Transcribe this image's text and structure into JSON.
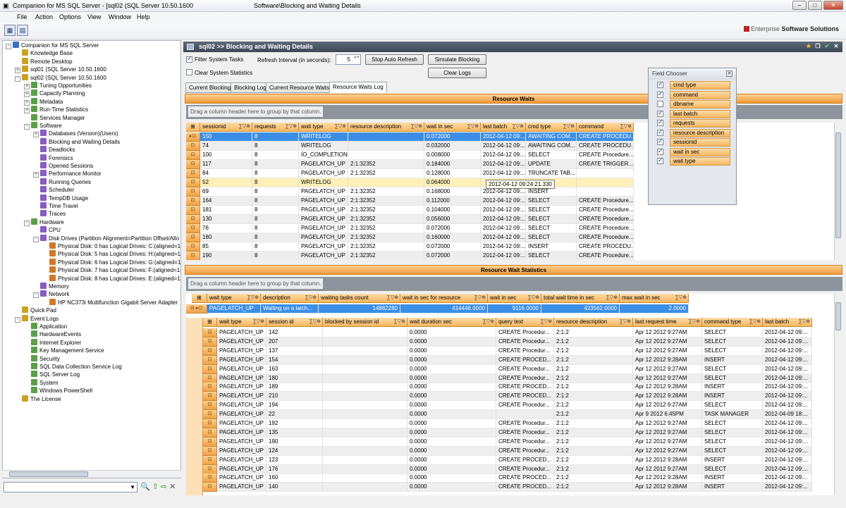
{
  "window": {
    "title": "Companion for MS SQL Server - [sql02 (SQL Server 10.50.1600",
    "center_title": "Software\\Blocking and Waiting Details",
    "controls": {
      "minimize": "–",
      "maximize": "□",
      "close": "✕"
    }
  },
  "menu": [
    "File",
    "Action",
    "Options",
    "View",
    "Window",
    "Help"
  ],
  "brand": {
    "prefix": "Enterprise",
    "name": "Software Solutions"
  },
  "tree": [
    {
      "label": "Companion for MS SQL Server",
      "level": 0,
      "exp": "-"
    },
    {
      "label": "Knowledge Base",
      "level": 1,
      "exp": ""
    },
    {
      "label": "Remote Desktop",
      "level": 1,
      "exp": ""
    },
    {
      "label": "sql01 (SQL Server 10.50.1600",
      "level": 1,
      "exp": "+"
    },
    {
      "label": "sql02 (SQL Server 10.50.1600",
      "level": 1,
      "exp": "-"
    },
    {
      "label": "Tuning Opportunities",
      "level": 2,
      "exp": "+"
    },
    {
      "label": "Capacity Planning",
      "level": 2,
      "exp": "+"
    },
    {
      "label": "Metadata",
      "level": 2,
      "exp": "+"
    },
    {
      "label": "Run-Time Statistics",
      "level": 2,
      "exp": "+"
    },
    {
      "label": "Services Manager",
      "level": 2,
      "exp": ""
    },
    {
      "label": "Software",
      "level": 2,
      "exp": "-"
    },
    {
      "label": "Databases (Version)(Users)",
      "level": 3,
      "exp": "+"
    },
    {
      "label": "Blocking and Waiting Details",
      "level": 3,
      "exp": ""
    },
    {
      "label": "Deadlocks",
      "level": 3,
      "exp": ""
    },
    {
      "label": "Forensics",
      "level": 3,
      "exp": ""
    },
    {
      "label": "Opened Sessions",
      "level": 3,
      "exp": ""
    },
    {
      "label": "Performance Monitor",
      "level": 3,
      "exp": "+"
    },
    {
      "label": "Running Queries",
      "level": 3,
      "exp": ""
    },
    {
      "label": "Scheduler",
      "level": 3,
      "exp": ""
    },
    {
      "label": "TempDB Usage",
      "level": 3,
      "exp": ""
    },
    {
      "label": "Time Travel",
      "level": 3,
      "exp": ""
    },
    {
      "label": "Traces",
      "level": 3,
      "exp": ""
    },
    {
      "label": "Hardware",
      "level": 2,
      "exp": "-"
    },
    {
      "label": "CPU",
      "level": 3,
      "exp": ""
    },
    {
      "label": "Disk Drives (Partition Alignment=Partition Offset/Allo",
      "level": 3,
      "exp": "-"
    },
    {
      "label": "Physical Disk: 0 has Logical Drives: C:(aligned=1(",
      "level": 4,
      "exp": ""
    },
    {
      "label": "Physical Disk: 5 has Logical Drives: H:(aligned=1(",
      "level": 4,
      "exp": ""
    },
    {
      "label": "Physical Disk: 6 has Logical Drives: G:(aligned=1(",
      "level": 4,
      "exp": ""
    },
    {
      "label": "Physical Disk: 7 has Logical Drives: F:(aligned=1(",
      "level": 4,
      "exp": ""
    },
    {
      "label": "Physical Disk: 8 has Logical Drives: E:(aligned=1(",
      "level": 4,
      "exp": ""
    },
    {
      "label": "Memory",
      "level": 3,
      "exp": ""
    },
    {
      "label": "Network",
      "level": 3,
      "exp": "-"
    },
    {
      "label": "HP NC373i Multifunction Gigabit Server Adapter",
      "level": 4,
      "exp": ""
    },
    {
      "label": "Quick Pad",
      "level": 1,
      "exp": ""
    },
    {
      "label": "Event Logs",
      "level": 1,
      "exp": "-"
    },
    {
      "label": "Application",
      "level": 2,
      "exp": ""
    },
    {
      "label": "HardwareEvents",
      "level": 2,
      "exp": ""
    },
    {
      "label": "Internet Explorer",
      "level": 2,
      "exp": ""
    },
    {
      "label": "Key Management Service",
      "level": 2,
      "exp": ""
    },
    {
      "label": "Security",
      "level": 2,
      "exp": ""
    },
    {
      "label": "SQL Data Collection Service Log",
      "level": 2,
      "exp": ""
    },
    {
      "label": "SQL Server Log",
      "level": 2,
      "exp": ""
    },
    {
      "label": "System",
      "level": 2,
      "exp": ""
    },
    {
      "label": "Windows PowerShell",
      "level": 2,
      "exp": ""
    },
    {
      "label": "The License",
      "level": 1,
      "exp": ""
    }
  ],
  "panel": {
    "title": "sql02 >> Blocking and Waiting Details",
    "filter_system_tasks": "Filter System Tasks",
    "clear_system_statistics": "Clear System Statistics",
    "refresh_label": "Refresh Interval (in seconds):",
    "refresh_value": "5",
    "stop_auto_refresh": "Stop Auto Refresh",
    "simulate_blocking": "Simulate Blocking",
    "clear_logs": "Clear Logs",
    "tabs": [
      "Current Blocking",
      "Blocking Log",
      "Current Resource Waits",
      "Resource Waits Log"
    ]
  },
  "resource_waits": {
    "band": "Resource Waits",
    "group_hint": "Drag a column header here to group by that column.",
    "columns": [
      "sessionid",
      "requests",
      "wait type",
      "resource description",
      "wait in sec",
      "last batch",
      "cmd type",
      "command"
    ],
    "rows": [
      [
        "150",
        "8",
        "WRITELOG",
        "",
        "0.072000",
        "2012-04-12  09:...",
        "AWAITING COM...",
        "CREATE PROCEDU..."
      ],
      [
        "74",
        "8",
        "WRITELOG",
        "",
        "0.032000",
        "2012-04-12  09:...",
        "AWAITING COM...",
        "CREATE PROCEDU..."
      ],
      [
        "100",
        "8",
        "IO_COMPLETION",
        "",
        "0.008000",
        "2012-04-12  09:...",
        "SELECT",
        "CREATE Procedure..."
      ],
      [
        "117",
        "8",
        "PAGELATCH_UP",
        "2:1:32352",
        "0.184000",
        "2012-04-12  09:...",
        "UPDATE",
        "CREATE TRIGGER..."
      ],
      [
        "84",
        "8",
        "PAGELATCH_UP",
        "2:1:32352",
        "0.128000",
        "2012-04-12  09:...",
        "TRUNCATE TAB...",
        ""
      ],
      [
        "52",
        "8",
        "WRITELOG",
        "",
        "0.064000",
        "",
        "",
        ""
      ],
      [
        "69",
        "8",
        "PAGELATCH_UP",
        "2:1:32352",
        "0.168000",
        "2012-04-12  09:...",
        "INSERT",
        ""
      ],
      [
        "164",
        "8",
        "PAGELATCH_UP",
        "2:1:32352",
        "0.112000",
        "2012-04-12  09:...",
        "SELECT",
        "CREATE Procedure..."
      ],
      [
        "181",
        "8",
        "PAGELATCH_UP",
        "2:1:32352",
        "0.104000",
        "2012-04-12  09:...",
        "SELECT",
        "CREATE Procedure..."
      ],
      [
        "130",
        "8",
        "PAGELATCH_UP",
        "2:1:32352",
        "0.056000",
        "2012-04-12  09:...",
        "SELECT",
        "CREATE Procedure..."
      ],
      [
        "76",
        "8",
        "PAGELATCH_UP",
        "2:1:32352",
        "0.072000",
        "2012-04-12  09:...",
        "SELECT",
        "CREATE Procedure..."
      ],
      [
        "180",
        "8",
        "PAGELATCH_UP",
        "2:1:32352",
        "0.160000",
        "2012-04-12  09:...",
        "SELECT",
        "CREATE Procedure..."
      ],
      [
        "85",
        "8",
        "PAGELATCH_UP",
        "2:1:32352",
        "0.072000",
        "2012-04-12  09:...",
        "INSERT",
        "CREATE PROCEDU..."
      ],
      [
        "190",
        "8",
        "PAGELATCH_UP",
        "2:1:32352",
        "0.072000",
        "2012-04-12  09:...",
        "SELECT",
        "CREATE Procedure..."
      ]
    ],
    "tooltip": "2012-04-12 09:24:21.330"
  },
  "field_chooser": {
    "title": "Field Chooser",
    "items": [
      {
        "name": "cmd type",
        "checked": true
      },
      {
        "name": "command",
        "checked": true
      },
      {
        "name": "dbname",
        "checked": false
      },
      {
        "name": "last batch",
        "checked": true
      },
      {
        "name": "requests",
        "checked": true
      },
      {
        "name": "resource description",
        "checked": true
      },
      {
        "name": "sessionid",
        "checked": true
      },
      {
        "name": "wait in sec",
        "checked": true
      },
      {
        "name": "wait type",
        "checked": true
      }
    ]
  },
  "wait_stats": {
    "band": "Resource Wait Statistics",
    "group_hint": "Drag a column header here to group by that column.",
    "columns": [
      "wait type",
      "description",
      "waiting tasks count",
      "wait in sec for resource",
      "wait in sec",
      "total wait time in sec",
      "max wait in sec"
    ],
    "row": [
      "PAGELATCH_UP",
      "Waiting on a latch...",
      "14882280",
      "414446.0000",
      "9116.0000",
      "423562.0000",
      "2.0000"
    ],
    "child_columns": [
      "wait type",
      "session id",
      "blocked by session id",
      "wait duration sec",
      "query text",
      "resource description",
      "last request time",
      "command type",
      "last batch"
    ],
    "child_rows": [
      [
        "PAGELATCH_UP",
        "142",
        "",
        "0.0000",
        "CREATE Procedur...",
        "2:1:2",
        "Apr 12 2012  9:27AM",
        "SELECT",
        "2012-04-12  09:..."
      ],
      [
        "PAGELATCH_UP",
        "207",
        "",
        "0.0000",
        "CREATE Procedur...",
        "2:1:2",
        "Apr 12 2012  9:27AM",
        "SELECT",
        "2012-04-12  09:..."
      ],
      [
        "PAGELATCH_UP",
        "137",
        "",
        "0.0000",
        "CREATE Procedur...",
        "2:1:2",
        "Apr 12 2012  9:27AM",
        "SELECT",
        "2012-04-12  09:..."
      ],
      [
        "PAGELATCH_UP",
        "154",
        "",
        "0.0000",
        "CREATE PROCED...",
        "2:1:2",
        "Apr 12 2012  9:28AM",
        "INSERT",
        "2012-04-12  09:..."
      ],
      [
        "PAGELATCH_UP",
        "163",
        "",
        "0.0000",
        "CREATE Procedur...",
        "2:1:2",
        "Apr 12 2012  9:27AM",
        "SELECT",
        "2012-04-12  09:..."
      ],
      [
        "PAGELATCH_UP",
        "180",
        "",
        "0.0000",
        "CREATE Procedur...",
        "2:1:2",
        "Apr 12 2012  9:27AM",
        "SELECT",
        "2012-04-12  09:..."
      ],
      [
        "PAGELATCH_UP",
        "189",
        "",
        "0.0000",
        "CREATE PROCED...",
        "2:1:2",
        "Apr 12 2012  9:28AM",
        "INSERT",
        "2012-04-12  09:..."
      ],
      [
        "PAGELATCH_UP",
        "210",
        "",
        "0.0000",
        "CREATE PROCED...",
        "2:1:2",
        "Apr 12 2012  9:28AM",
        "INSERT",
        "2012-04-12  09:..."
      ],
      [
        "PAGELATCH_UP",
        "194",
        "",
        "0.0000",
        "CREATE Procedur...",
        "2:1:2",
        "Apr 12 2012  9:27AM",
        "SELECT",
        "2012-04-12  09:..."
      ],
      [
        "PAGELATCH_UP",
        "22",
        "",
        "0.0000",
        "",
        "2:1:2",
        "Apr  9 2012  6:45PM",
        "TASK MANAGER",
        "2012-04-09  18:..."
      ],
      [
        "PAGELATCH_UP",
        "192",
        "",
        "0.0000",
        "CREATE Procedur...",
        "2:1:2",
        "Apr 12 2012  9:27AM",
        "SELECT",
        "2012-04-12  09:..."
      ],
      [
        "PAGELATCH_UP",
        "135",
        "",
        "0.0000",
        "CREATE Procedur...",
        "2:1:2",
        "Apr 12 2012  9:27AM",
        "SELECT",
        "2012-04-12  09:..."
      ],
      [
        "PAGELATCH_UP",
        "190",
        "",
        "0.0000",
        "CREATE Procedur...",
        "2:1:2",
        "Apr 12 2012  9:27AM",
        "SELECT",
        "2012-04-12  09:..."
      ],
      [
        "PAGELATCH_UP",
        "124",
        "",
        "0.0000",
        "CREATE Procedur...",
        "2:1:2",
        "Apr 12 2012  9:27AM",
        "SELECT",
        "2012-04-12  09:..."
      ],
      [
        "PAGELATCH_UP",
        "123",
        "",
        "0.0000",
        "CREATE PROCED...",
        "2:1:2",
        "Apr 12 2012  9:28AM",
        "INSERT",
        "2012-04-12  09:..."
      ],
      [
        "PAGELATCH_UP",
        "176",
        "",
        "0.0000",
        "CREATE Procedur...",
        "2:1:2",
        "Apr 12 2012  9:27AM",
        "SELECT",
        "2012-04-12  09:..."
      ],
      [
        "PAGELATCH_UP",
        "160",
        "",
        "0.0000",
        "CREATE PROCED...",
        "2:1:2",
        "Apr 12 2012  9:28AM",
        "INSERT",
        "2012-04-12  09:..."
      ],
      [
        "PAGELATCH_UP",
        "140",
        "",
        "0.0000",
        "CREATE PROCED...",
        "2:1:2",
        "Apr 12 2012  9:28AM",
        "INSERT",
        "2012-04-12  09:..."
      ]
    ]
  },
  "colors": {
    "header_orange": "#f7b65e",
    "selected_row": "#3b8ee6",
    "highlight_row": "#fdf0b8",
    "title_bar": "#3d4755"
  }
}
